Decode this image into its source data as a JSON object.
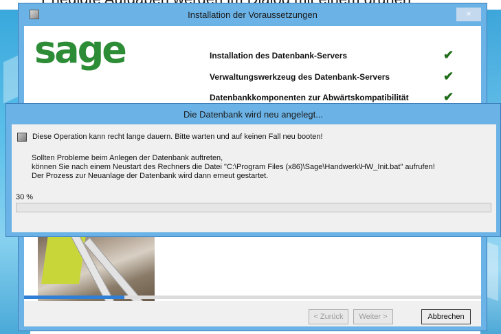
{
  "background_text": {
    "line": "Erledigte Aufgaben werden im Dialog mit einem grünen",
    "link_word": "Aufgaben"
  },
  "window": {
    "title": "Installation der Voraussetzungen",
    "close_label": "×",
    "logo_text": "sage",
    "requirements": [
      {
        "label": "Installation des Datenbank-Servers",
        "status": "✔"
      },
      {
        "label": "Verwaltungswerkzeug des Datenbank-Servers",
        "status": "✔"
      },
      {
        "label": "Datenbankkomponenten zur Abwärtskompatibilität",
        "status": "✔"
      }
    ],
    "overall_progress_fraction": 0.22,
    "buttons": {
      "back": "< Zurück",
      "next": "Weiter >",
      "cancel": "Abbrechen"
    }
  },
  "dialog": {
    "title": "Die Datenbank wird neu angelegt...",
    "warning": "Diese Operation kann recht lange dauern. Bitte warten und auf keinen Fall neu booten!",
    "info_lines": [
      "Sollten Probleme beim Anlegen der Datenbank auftreten,",
      "können Sie nach einem Neustart des Rechners die Datei \"C:\\Program Files (x86)\\Sage\\Handwerk\\HW_Init.bat\" aufrufen!",
      "Der Prozess zur Neuanlage der Datenbank wird dann erneut gestartet."
    ],
    "progress_label": "30 %",
    "progress_percent": 30
  },
  "colors": {
    "title_bar": "#6bb3e6",
    "sage_green": "#2d8c36",
    "check_green": "#1f6d1a",
    "progress_blue": "#2f7fd6"
  }
}
